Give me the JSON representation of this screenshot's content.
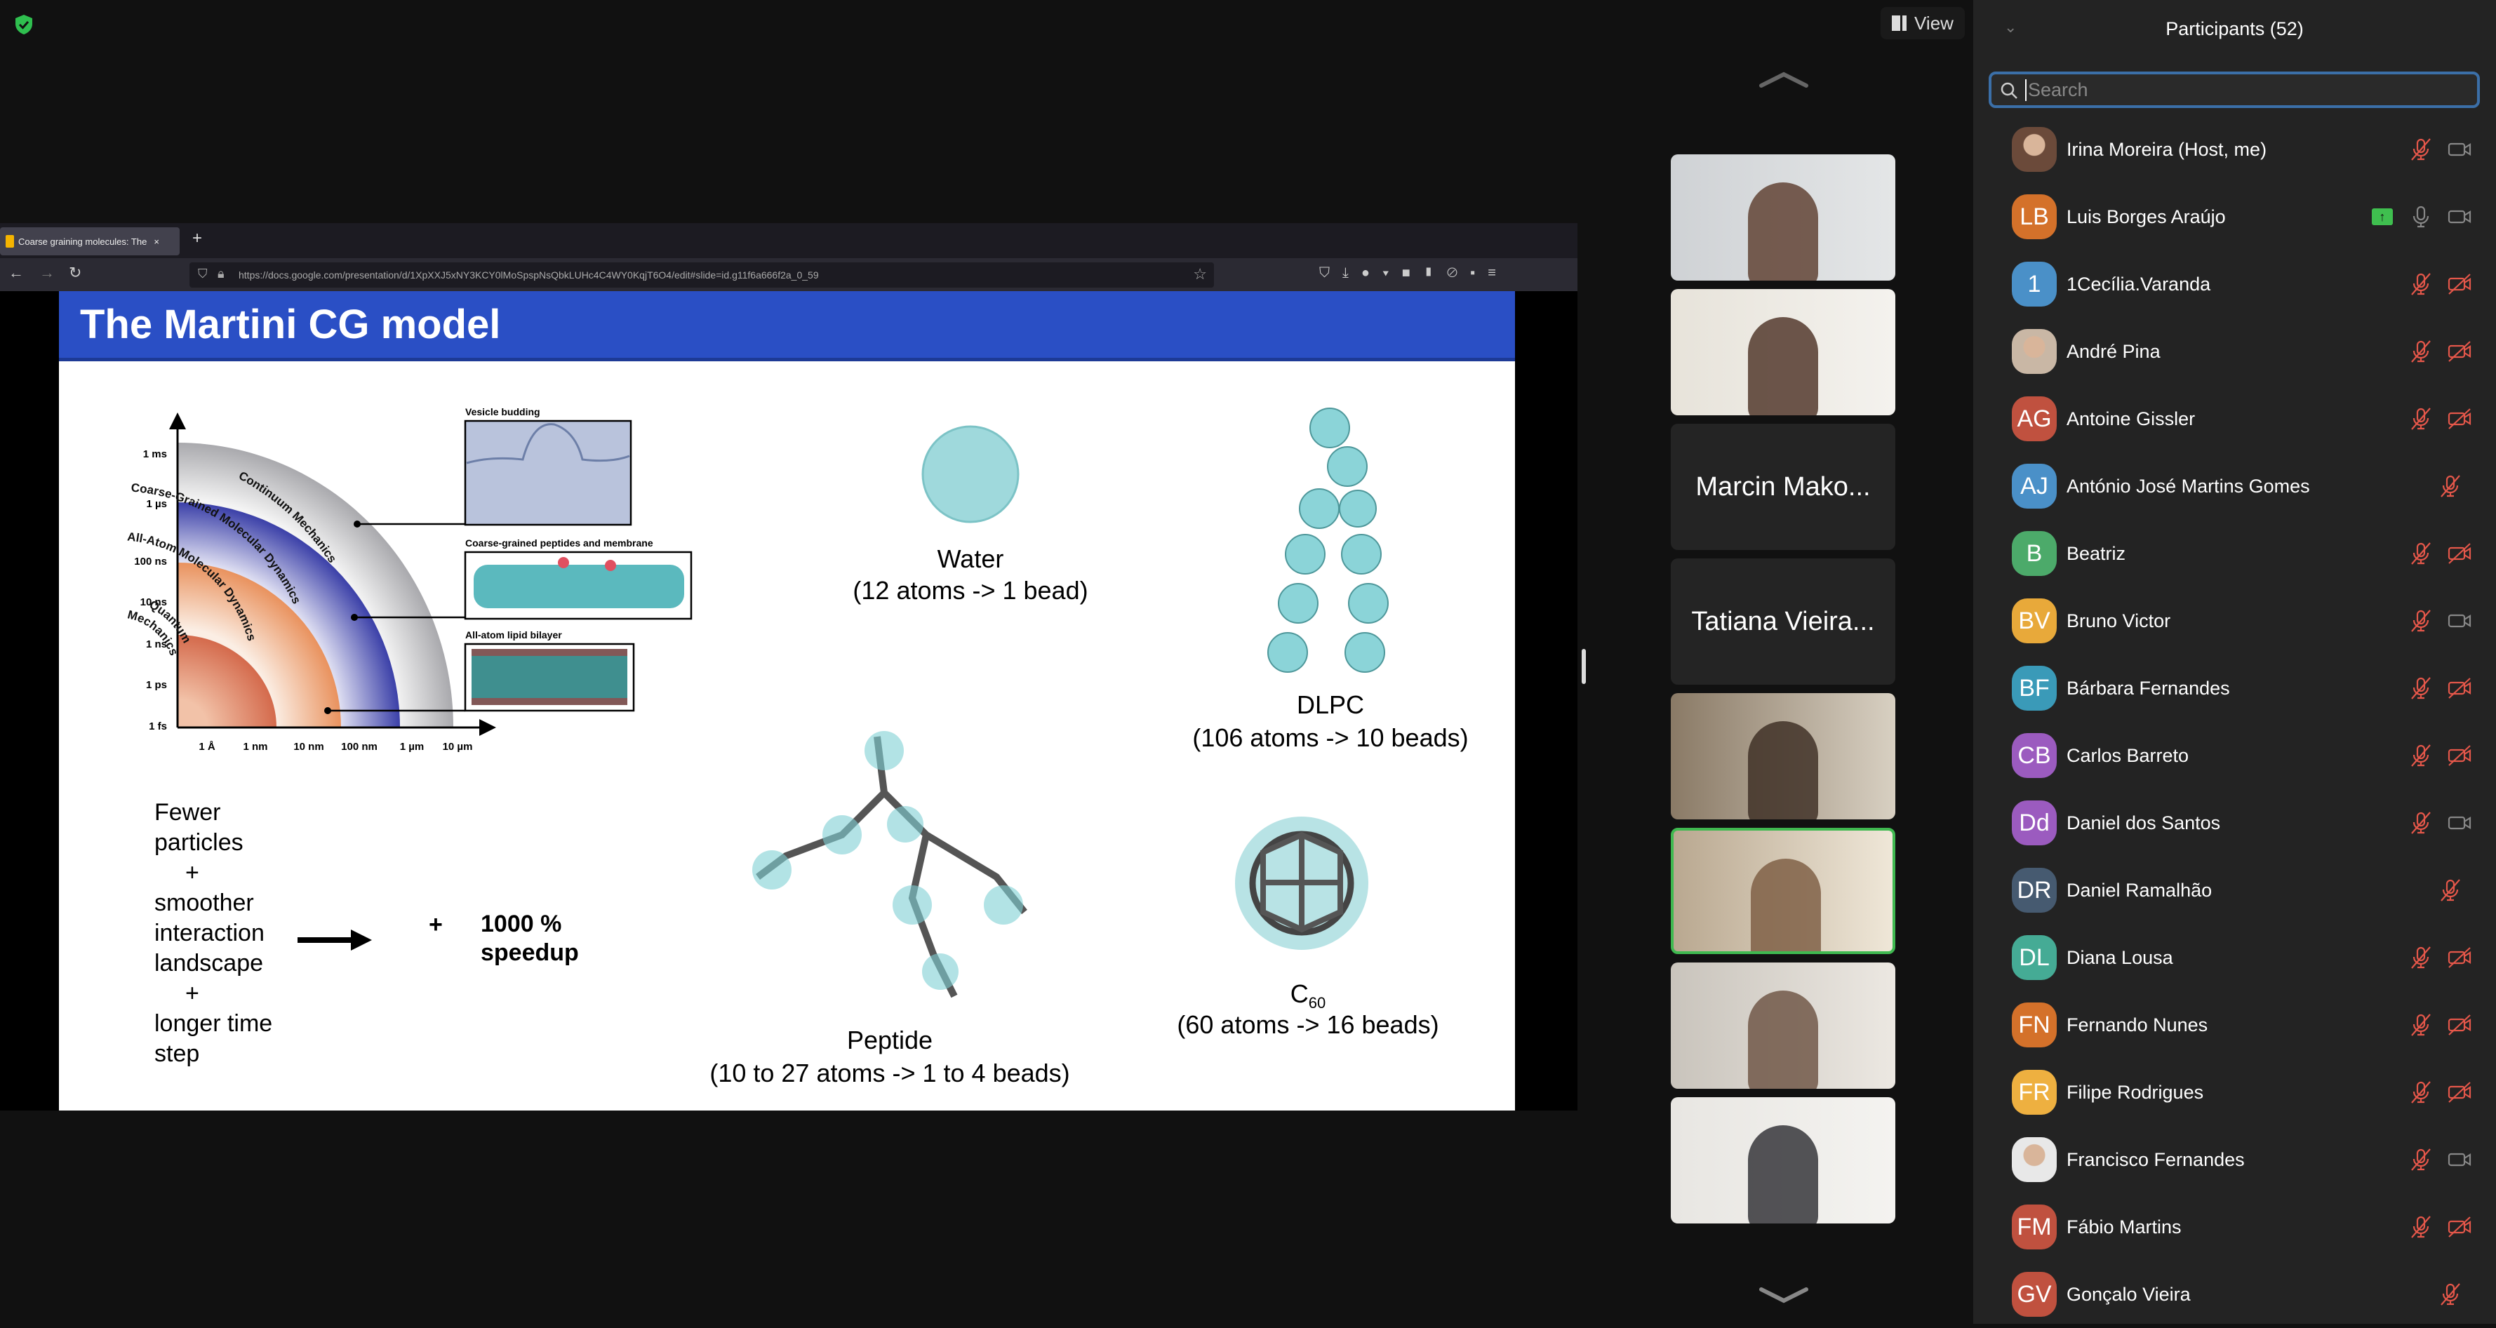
{
  "toolbar": {
    "view_label": "View"
  },
  "browser": {
    "tab_title": "Coarse graining molecules: The",
    "tab_close": "×",
    "new_tab": "+",
    "url": "https://docs.google.com/presentation/d/1XpXXJ5xNY3KCY0lMoSpspNsQbkLUHc4C4WY0KqjT6O4/edit#slide=id.g11f6a666f2a_0_59"
  },
  "slide": {
    "title": "The Martini CG model",
    "diagram": {
      "y_ticks": [
        "1 ms",
        "1 µs",
        "100 ns",
        "10 ns",
        "1 ns",
        "1 ps",
        "1 fs"
      ],
      "x_ticks": [
        "1 Å",
        "1 nm",
        "10 nm",
        "100 nm",
        "1 µm",
        "10 µm"
      ],
      "regions": [
        "Continuum Mechanics",
        "Coarse-Grained Molecular Dynamics",
        "All-Atom Molecular Dynamics",
        "Quantum",
        "Mechanics"
      ],
      "insets": [
        "Vesicle budding",
        "Coarse-grained peptides and membrane",
        "All-atom lipid bilayer"
      ]
    },
    "water": {
      "name": "Water",
      "desc": "(12 atoms -> 1 bead)"
    },
    "dlpc": {
      "name": "DLPC",
      "desc": "(106 atoms -> 10 beads)"
    },
    "peptide": {
      "name": "Peptide",
      "desc": "(10 to 27 atoms -> 1 to 4 beads)"
    },
    "c60": {
      "name": "C",
      "sub": "60",
      "desc": "(60 atoms -> 16 beads)"
    },
    "left_text": [
      "Fewer",
      "particles",
      "+",
      "smoother",
      "interaction",
      "landscape",
      "+",
      "longer time",
      "step"
    ],
    "plus": "+",
    "speedup": [
      "1000 %",
      "speedup"
    ]
  },
  "gallery": {
    "tiles": [
      {
        "type": "video",
        "name": ""
      },
      {
        "type": "video",
        "name": ""
      },
      {
        "type": "name",
        "name": "Marcin Mako..."
      },
      {
        "type": "name",
        "name": "Tatiana Vieira..."
      },
      {
        "type": "video",
        "name": ""
      },
      {
        "type": "video",
        "name": "",
        "active": true
      },
      {
        "type": "video",
        "name": ""
      },
      {
        "type": "video",
        "name": ""
      }
    ]
  },
  "participants": {
    "title": "Participants (52)",
    "search_placeholder": "Search",
    "list": [
      {
        "name": "Irina Moreira (Host, me)",
        "initials": "",
        "color": "#6b4a3a",
        "photo": true,
        "mic": "muted",
        "video": "on"
      },
      {
        "name": "Luis Borges Araújo",
        "initials": "LB",
        "color": "#d4712a",
        "mic": "on",
        "video": "on",
        "share": true
      },
      {
        "name": "1Cecília.Varanda",
        "initials": "1",
        "color": "#4a90c8",
        "mic": "muted",
        "video": "off"
      },
      {
        "name": "André Pina",
        "initials": "",
        "color": "#c9b7a5",
        "photo": true,
        "mic": "muted",
        "video": "off"
      },
      {
        "name": "Antoine Gissler",
        "initials": "AG",
        "color": "#c0513f",
        "mic": "muted",
        "video": "off"
      },
      {
        "name": "António José Martins Gomes",
        "initials": "AJ",
        "color": "#4a90c8",
        "mic": "muted",
        "video": "none"
      },
      {
        "name": "Beatriz",
        "initials": "B",
        "color": "#4caa6a",
        "mic": "muted",
        "video": "off"
      },
      {
        "name": "Bruno Victor",
        "initials": "BV",
        "color": "#e8a93a",
        "mic": "muted",
        "video": "on"
      },
      {
        "name": "Bárbara Fernandes",
        "initials": "BF",
        "color": "#3a9ab8",
        "mic": "muted",
        "video": "off"
      },
      {
        "name": "Carlos Barreto",
        "initials": "CB",
        "color": "#9b5bbf",
        "mic": "muted",
        "video": "off"
      },
      {
        "name": "Daniel dos Santos",
        "initials": "Dd",
        "color": "#9b5bbf",
        "mic": "muted",
        "video": "on"
      },
      {
        "name": "Daniel Ramalhão",
        "initials": "DR",
        "color": "#465a70",
        "mic": "muted",
        "video": "none"
      },
      {
        "name": "Diana Lousa",
        "initials": "DL",
        "color": "#45ab95",
        "mic": "muted",
        "video": "off"
      },
      {
        "name": "Fernando Nunes",
        "initials": "FN",
        "color": "#d4712a",
        "mic": "muted",
        "video": "off"
      },
      {
        "name": "Filipe Rodrigues",
        "initials": "FR",
        "color": "#eeb040",
        "mic": "muted",
        "video": "off"
      },
      {
        "name": "Francisco Fernandes",
        "initials": "",
        "color": "#e8e8e8",
        "photo": true,
        "mic": "muted",
        "video": "on"
      },
      {
        "name": "Fábio Martins",
        "initials": "FM",
        "color": "#c0513f",
        "mic": "muted",
        "video": "off"
      },
      {
        "name": "Gonçalo Vieira",
        "initials": "GV",
        "color": "#c0513f",
        "mic": "muted",
        "video": "none"
      }
    ]
  },
  "colors": {
    "slide_title_bg": "#2a4fc5",
    "muted": "#e5574a",
    "panel_bg": "#232323",
    "active_border": "#3fb950"
  }
}
